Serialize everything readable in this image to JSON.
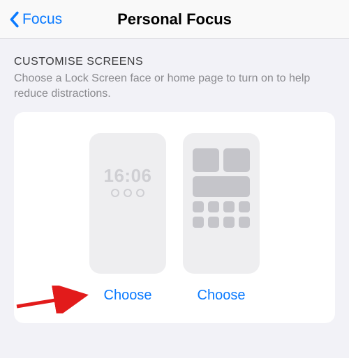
{
  "nav": {
    "back_label": "Focus",
    "title": "Personal Focus"
  },
  "section": {
    "header": "CUSTOMISE SCREENS",
    "description": "Choose a Lock Screen face or home page to turn on to help reduce distractions."
  },
  "previews": {
    "lock": {
      "time": "16:06",
      "choose_label": "Choose"
    },
    "home": {
      "choose_label": "Choose"
    }
  },
  "colors": {
    "accent": "#0a7aff"
  }
}
